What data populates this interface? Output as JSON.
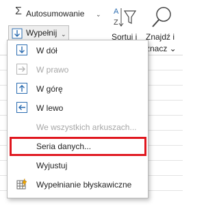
{
  "ribbon": {
    "autosum_label": "Autosumowanie",
    "fill_label": "Wypełnij",
    "sort_label": "Sortuj i",
    "find_label_line1": "Znajdź i",
    "find_label_line2": "znacz ⌄"
  },
  "menu": {
    "items": [
      {
        "label": "W dół",
        "icon": "arrow-down-icon",
        "disabled": false
      },
      {
        "label": "W prawo",
        "icon": "arrow-right-icon",
        "disabled": true
      },
      {
        "label": "W górę",
        "icon": "arrow-up-icon",
        "disabled": false
      },
      {
        "label": "W lewo",
        "icon": "arrow-left-icon",
        "disabled": false
      },
      {
        "label": "We wszystkich arkuszach...",
        "icon": "",
        "disabled": true
      },
      {
        "label": "Seria danych...",
        "icon": "",
        "disabled": false,
        "highlighted": true
      },
      {
        "label": "Wyjustuj",
        "icon": "",
        "disabled": false
      },
      {
        "label": "Wypełnianie błyskawiczne",
        "icon": "flash-fill-icon",
        "disabled": false
      }
    ]
  },
  "colors": {
    "accent_blue": "#2b6cb0",
    "highlight_red": "#e0161e",
    "disabled_gray": "#a6a6a6"
  }
}
